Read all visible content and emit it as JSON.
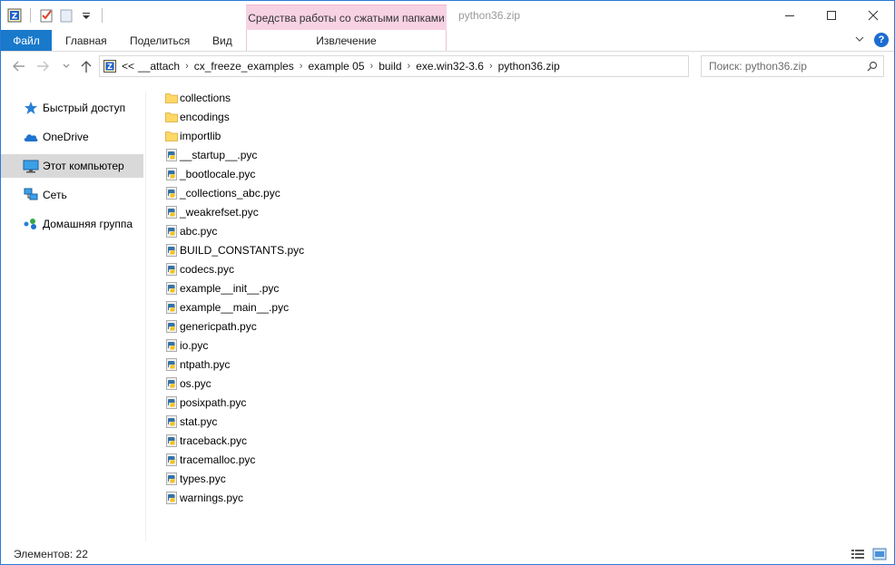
{
  "titlebar": {
    "context_tab_label": "Средства работы со сжатыми папками",
    "window_title": "python36.zip",
    "qat_icons": [
      "zip-folder-icon",
      "properties-checkmark-icon",
      "new-folder-icon",
      "customize-dropdown-icon"
    ],
    "buttons": [
      "minimize-icon",
      "maximize-icon",
      "close-icon"
    ]
  },
  "ribbon": {
    "tabs": [
      {
        "label": "Файл"
      },
      {
        "label": "Главная"
      },
      {
        "label": "Поделиться"
      },
      {
        "label": "Вид"
      },
      {
        "label": "Извлечение"
      }
    ],
    "expand_icon": "chevron-down-icon",
    "help_label": "?"
  },
  "address": {
    "prefix": "<<",
    "crumbs": [
      "__attach",
      "cx_freeze_examples",
      "example 05",
      "build",
      "exe.win32-3.6",
      "python36.zip"
    ],
    "search_placeholder": "Поиск: python36.zip"
  },
  "sidebar": {
    "items": [
      {
        "label": "Быстрый доступ",
        "icon": "star-icon"
      },
      {
        "label": "OneDrive",
        "icon": "cloud-icon"
      },
      {
        "label": "Этот компьютер",
        "icon": "computer-icon"
      },
      {
        "label": "Сеть",
        "icon": "network-icon"
      },
      {
        "label": "Домашняя группа",
        "icon": "homegroup-icon"
      }
    ]
  },
  "files": [
    {
      "name": "collections",
      "type": "folder"
    },
    {
      "name": "encodings",
      "type": "folder"
    },
    {
      "name": "importlib",
      "type": "folder"
    },
    {
      "name": "__startup__.pyc",
      "type": "pyc"
    },
    {
      "name": "_bootlocale.pyc",
      "type": "pyc"
    },
    {
      "name": "_collections_abc.pyc",
      "type": "pyc"
    },
    {
      "name": "_weakrefset.pyc",
      "type": "pyc"
    },
    {
      "name": "abc.pyc",
      "type": "pyc"
    },
    {
      "name": "BUILD_CONSTANTS.pyc",
      "type": "pyc"
    },
    {
      "name": "codecs.pyc",
      "type": "pyc"
    },
    {
      "name": "example__init__.pyc",
      "type": "pyc"
    },
    {
      "name": "example__main__.pyc",
      "type": "pyc"
    },
    {
      "name": "genericpath.pyc",
      "type": "pyc"
    },
    {
      "name": "io.pyc",
      "type": "pyc"
    },
    {
      "name": "ntpath.pyc",
      "type": "pyc"
    },
    {
      "name": "os.pyc",
      "type": "pyc"
    },
    {
      "name": "posixpath.pyc",
      "type": "pyc"
    },
    {
      "name": "stat.pyc",
      "type": "pyc"
    },
    {
      "name": "traceback.pyc",
      "type": "pyc"
    },
    {
      "name": "tracemalloc.pyc",
      "type": "pyc"
    },
    {
      "name": "types.pyc",
      "type": "pyc"
    },
    {
      "name": "warnings.pyc",
      "type": "pyc"
    }
  ],
  "status": {
    "items_count": "Элементов: 22"
  },
  "colors": {
    "accent": "#1979ca",
    "context_tab": "#f7d2e3",
    "folder": "#ffd866",
    "selected": "#d9d9d9"
  }
}
